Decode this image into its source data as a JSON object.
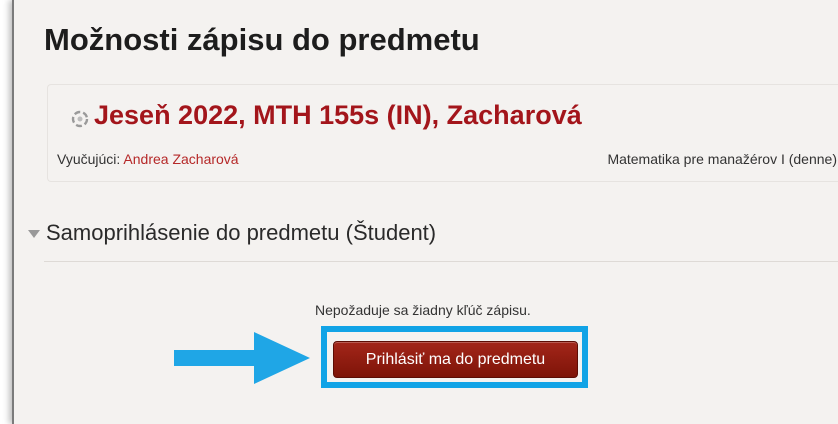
{
  "page": {
    "title": "Možnosti zápisu do predmetu"
  },
  "course": {
    "name": "Jeseň 2022, MTH 155s (IN), Zacharová",
    "teacher_label": "Vyučujúci: ",
    "teacher_name": "Andrea Zacharová",
    "category": "Matematika pre manažérov I (denne)",
    "icon": "course-icon"
  },
  "self_enrol": {
    "section_title": "Samoprihlásenie do predmetu (Študent)",
    "no_key_text": "Nepožaduje sa žiadny kľúč zápisu.",
    "button_label": "Prihlásiť ma do predmetu"
  },
  "colors": {
    "course_title": "#a3151b",
    "link": "#b52828",
    "button": "#8e1a10",
    "highlight_border": "#11a3e6",
    "arrow": "#1fa6e6"
  }
}
